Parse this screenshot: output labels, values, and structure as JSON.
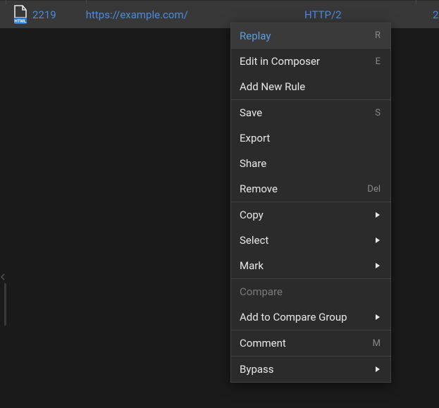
{
  "row": {
    "id": "2219",
    "url": "https://example.com/",
    "protocol": "HTTP/2",
    "trailing": "2"
  },
  "contextMenu": {
    "items": [
      {
        "label": "Replay",
        "shortcut": "R",
        "highlighted": true
      },
      {
        "label": "Edit in Composer",
        "shortcut": "E"
      },
      {
        "label": "Add New Rule"
      },
      {
        "sep": true
      },
      {
        "label": "Save",
        "shortcut": "S"
      },
      {
        "label": "Export"
      },
      {
        "label": "Share"
      },
      {
        "label": "Remove",
        "shortcut": "Del"
      },
      {
        "sep": true
      },
      {
        "label": "Copy",
        "submenu": true
      },
      {
        "label": "Select",
        "submenu": true
      },
      {
        "label": "Mark",
        "submenu": true
      },
      {
        "sep": true
      },
      {
        "label": "Compare",
        "disabled": true
      },
      {
        "label": "Add to Compare Group",
        "submenu": true
      },
      {
        "sep": true
      },
      {
        "label": "Comment",
        "shortcut": "M"
      },
      {
        "sep": true
      },
      {
        "label": "Bypass",
        "submenu": true
      }
    ]
  }
}
